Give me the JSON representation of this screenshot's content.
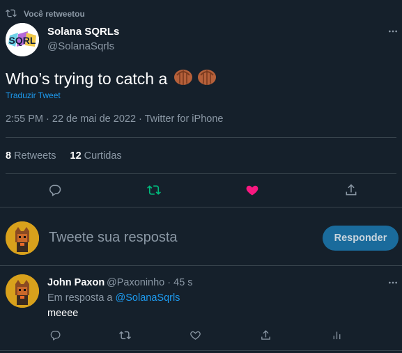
{
  "retweet_context": {
    "label": "Você retweetou"
  },
  "tweet": {
    "author_name": "Solana SQRLs",
    "author_handle": "@SolanaSqrls",
    "avatar_text": "SQRL",
    "text": "Who’s trying to catch a",
    "emoji": [
      "acorn-icon",
      "acorn-icon"
    ],
    "translate_label": "Traduzir Tweet",
    "timestamp": "2:55 PM · 22 de mai de 2022 · Twitter for iPhone",
    "retweets_count": "8",
    "retweets_label": "Retweets",
    "likes_count": "12",
    "likes_label": "Curtidas",
    "liked": true,
    "retweeted": true
  },
  "reply_box": {
    "placeholder": "Tweete sua resposta",
    "button_label": "Responder"
  },
  "comment": {
    "author_name": "John Paxon",
    "meta": "@Paxoninho · 45 s",
    "reply_to_prefix": "Em resposta a",
    "reply_to_handle": "@SolanaSqrls",
    "text": "meeee"
  },
  "colors": {
    "background": "#15202b",
    "link": "#1d9bf0",
    "retweet_green": "#00ba7c",
    "like_pink": "#f91880",
    "muted": "#8b98a5"
  }
}
